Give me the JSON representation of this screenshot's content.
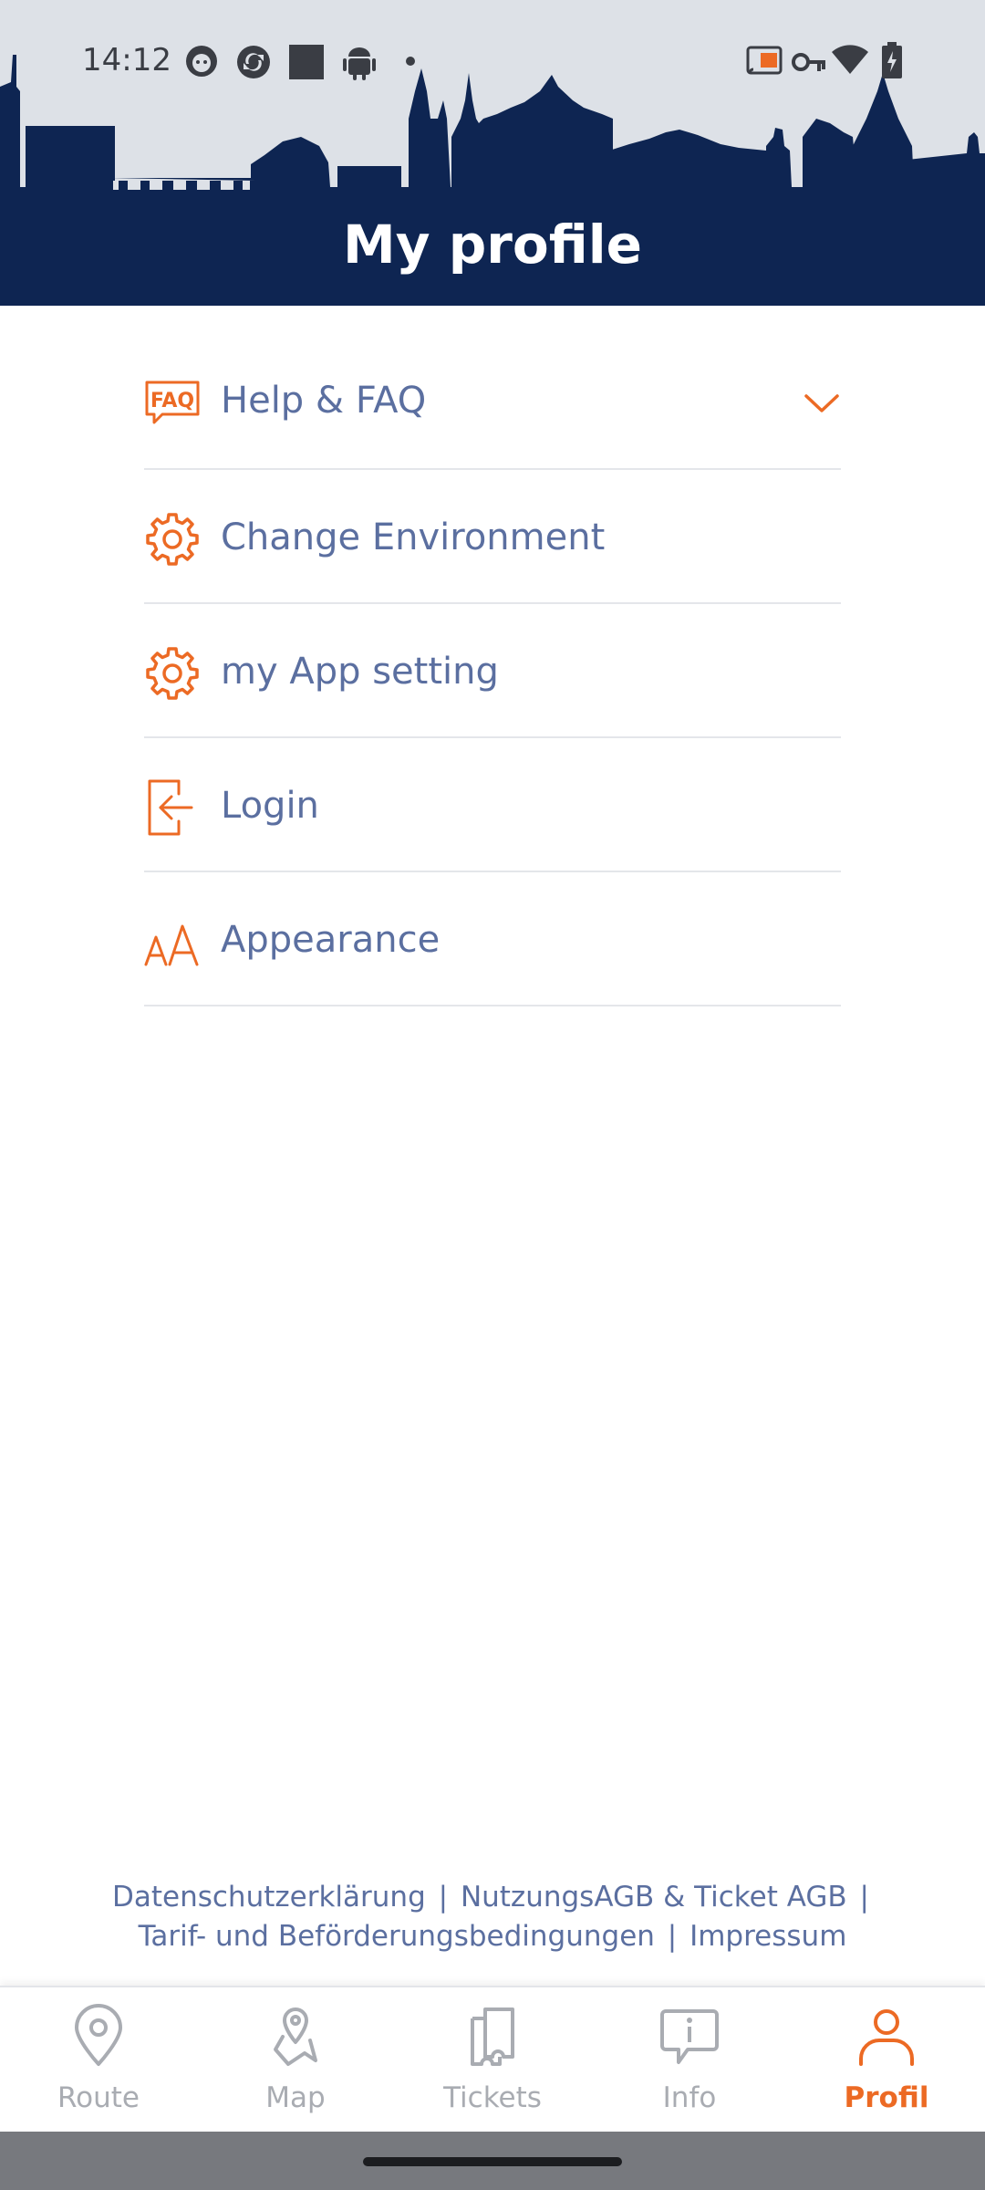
{
  "status_bar": {
    "time": "14:12",
    "left_icons": [
      "cat-notification-icon",
      "sync-icon",
      "square-icon",
      "android-icon",
      "dot-icon"
    ],
    "right_icons": [
      "cast-icon",
      "key-icon",
      "wifi-icon",
      "battery-charging-icon"
    ]
  },
  "header": {
    "title": "My profile",
    "background_color": "#0e2552"
  },
  "menu": {
    "items": [
      {
        "label": "Help & FAQ",
        "icon": "faq-icon",
        "expandable": true
      },
      {
        "label": "Change Environment",
        "icon": "gear-icon"
      },
      {
        "label": "my App setting",
        "icon": "gear-icon"
      },
      {
        "label": "Login",
        "icon": "login-icon"
      },
      {
        "label": "Appearance",
        "icon": "font-size-icon"
      }
    ]
  },
  "footer": {
    "link_privacy": "Datenschutzerklärung",
    "link_terms": "NutzungsAGB & Ticket AGB",
    "link_tariff": "Tarif- und Beförderungsbedingungen",
    "link_imprint": "Impressum",
    "separator": "|"
  },
  "bottom_nav": {
    "items": [
      {
        "label": "Route",
        "icon": "map-pin-icon",
        "active": false
      },
      {
        "label": "Map",
        "icon": "map-person-icon",
        "active": false
      },
      {
        "label": "Tickets",
        "icon": "ticket-icon",
        "active": false
      },
      {
        "label": "Info",
        "icon": "info-bubble-icon",
        "active": false
      },
      {
        "label": "Profil",
        "icon": "user-icon",
        "active": true
      }
    ]
  },
  "colors": {
    "accent": "#ec6a24",
    "navy": "#0e2552",
    "text": "#5b6fa0",
    "inactive": "#a9acb2"
  }
}
